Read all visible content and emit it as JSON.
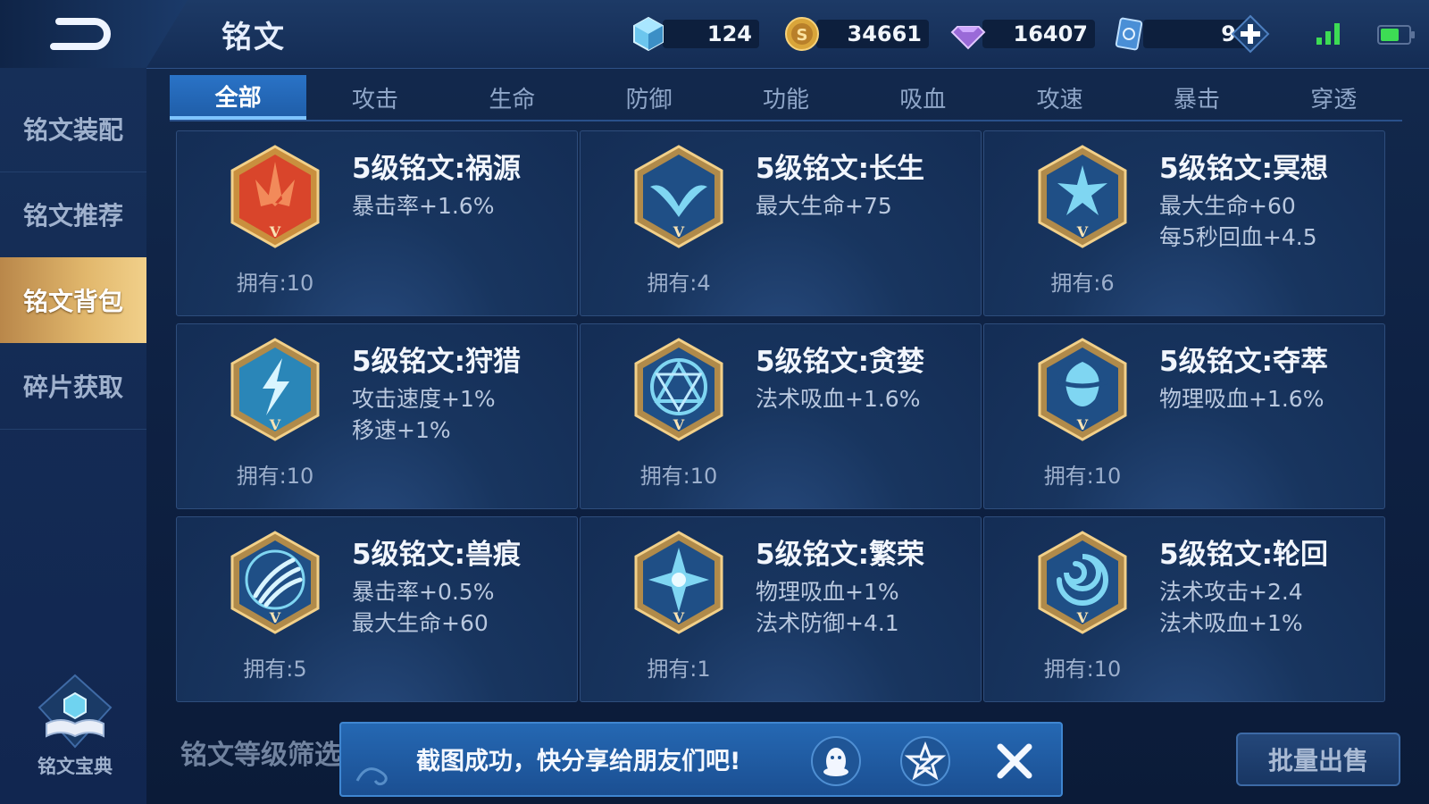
{
  "header": {
    "title": "铭文",
    "currencies": [
      {
        "icon": "diamond-cube-icon",
        "value": "124"
      },
      {
        "icon": "gold-coin-icon",
        "value": "34661"
      },
      {
        "icon": "purple-gem-icon",
        "value": "16407"
      },
      {
        "icon": "ticket-card-icon",
        "value": "9"
      }
    ]
  },
  "sidebar": {
    "items": [
      {
        "label": "铭文装配"
      },
      {
        "label": "铭文推荐"
      },
      {
        "label": "铭文背包"
      },
      {
        "label": "碎片获取"
      }
    ],
    "active_index": 2,
    "codex_label": "铭文宝典"
  },
  "tabs": [
    "全部",
    "攻击",
    "生命",
    "防御",
    "功能",
    "吸血",
    "攻速",
    "暴击",
    "穿透"
  ],
  "active_tab": 0,
  "cards": [
    {
      "title": "5级铭文:祸源",
      "stats": [
        "暴击率+1.6%",
        ""
      ],
      "owned": "拥有:10",
      "icon": "red-rune-gem-icon"
    },
    {
      "title": "5级铭文:长生",
      "stats": [
        "最大生命+75",
        ""
      ],
      "owned": "拥有:4",
      "icon": "blue-wing-rune-gem-icon"
    },
    {
      "title": "5级铭文:冥想",
      "stats": [
        "最大生命+60",
        "每5秒回血+4.5"
      ],
      "owned": "拥有:6",
      "icon": "blue-star-rune-gem-icon"
    },
    {
      "title": "5级铭文:狩猎",
      "stats": [
        "攻击速度+1%",
        "移速+1%"
      ],
      "owned": "拥有:10",
      "icon": "lightning-rune-gem-icon"
    },
    {
      "title": "5级铭文:贪婪",
      "stats": [
        "法术吸血+1.6%",
        ""
      ],
      "owned": "拥有:10",
      "icon": "triangle-rune-gem-icon"
    },
    {
      "title": "5级铭文:夺萃",
      "stats": [
        "物理吸血+1.6%",
        ""
      ],
      "owned": "拥有:10",
      "icon": "knot-rune-gem-icon"
    },
    {
      "title": "5级铭文:兽痕",
      "stats": [
        "暴击率+0.5%",
        "最大生命+60"
      ],
      "owned": "拥有:5",
      "icon": "claw-rune-gem-icon"
    },
    {
      "title": "5级铭文:繁荣",
      "stats": [
        "物理吸血+1%",
        "法术防御+4.1"
      ],
      "owned": "拥有:1",
      "icon": "star-burst-rune-gem-icon"
    },
    {
      "title": "5级铭文:轮回",
      "stats": [
        "法术攻击+2.4",
        "法术吸血+1%"
      ],
      "owned": "拥有:10",
      "icon": "swirl-rune-gem-icon"
    }
  ],
  "gem_level_mark": "V",
  "footer": {
    "filter_label": "铭文等级筛选",
    "toast_message": "截图成功，快分享给朋友们吧!",
    "sell_label": "批量出售"
  },
  "colors": {
    "accent_blue": "#2a73c7",
    "active_gold": "#e2b86d",
    "rune_red": "#d9452b",
    "rune_cyan": "#7fd6f2"
  }
}
